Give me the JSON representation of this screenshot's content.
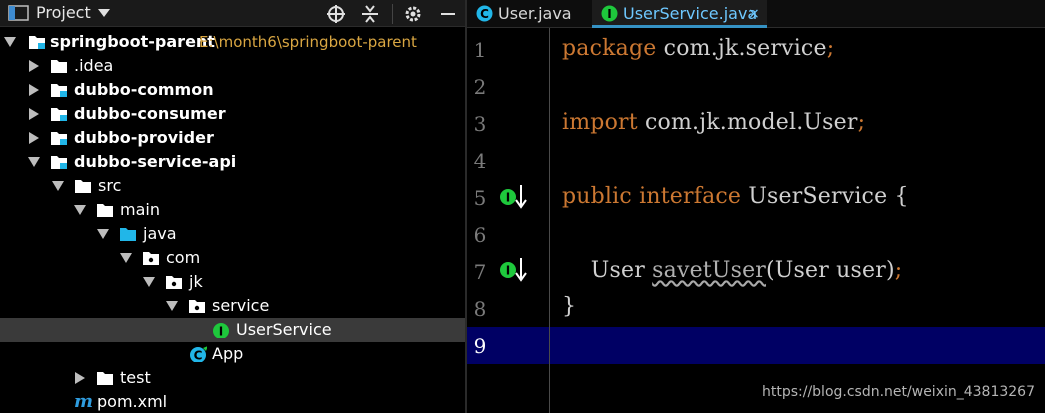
{
  "project_panel": {
    "title": "Project",
    "tree": [
      {
        "label": "springboot-parent",
        "path": "E:\\month6\\springboot-parent",
        "icon": "module-folder-icon",
        "expanded": true
      },
      {
        "label": ".idea",
        "icon": "folder-icon",
        "expanded": false
      },
      {
        "label": "dubbo-common",
        "icon": "module-folder-icon",
        "expanded": false
      },
      {
        "label": "dubbo-consumer",
        "icon": "module-folder-icon",
        "expanded": false
      },
      {
        "label": "dubbo-provider",
        "icon": "module-folder-icon",
        "expanded": false
      },
      {
        "label": "dubbo-service-api",
        "icon": "module-folder-icon",
        "expanded": true
      },
      {
        "label": "src",
        "icon": "folder-icon",
        "expanded": true
      },
      {
        "label": "main",
        "icon": "folder-icon",
        "expanded": true
      },
      {
        "label": "java",
        "icon": "source-folder-icon",
        "expanded": true
      },
      {
        "label": "com",
        "icon": "package-icon",
        "expanded": true
      },
      {
        "label": "jk",
        "icon": "package-icon",
        "expanded": true
      },
      {
        "label": "service",
        "icon": "package-icon",
        "expanded": true
      },
      {
        "label": "UserService",
        "icon": "interface-icon",
        "selected": true
      },
      {
        "label": "App",
        "icon": "class-icon"
      },
      {
        "label": "test",
        "icon": "folder-icon",
        "expanded": false
      },
      {
        "label": "pom.xml",
        "icon": "maven-icon"
      }
    ]
  },
  "editor": {
    "tabs": [
      {
        "label": "User.java",
        "icon": "class-icon",
        "active": false
      },
      {
        "label": "UserService.java",
        "icon": "interface-icon",
        "active": true,
        "close": "×"
      }
    ],
    "line_numbers": [
      "1",
      "2",
      "3",
      "4",
      "5",
      "6",
      "7",
      "8",
      "9"
    ],
    "lines": {
      "l1_kw": "package",
      "l1_rest": " com.jk.service",
      "l3_kw": "import",
      "l3_rest": " com.jk.model.User",
      "semi": ";",
      "l5_kw1": "public",
      "l5_kw2": "interface",
      "l5_rest": " UserService {",
      "l7_type": "    User ",
      "l7_method": "savetUser",
      "l7_params": "(User user)",
      "l8": "}"
    },
    "current_line": "9"
  },
  "watermark": "https://blog.csdn.net/weixin_43813267",
  "colors": {
    "keyword": "#cc7832",
    "interface_icon": "#1ec83c",
    "class_icon": "#21b6e8",
    "current_line_bg": "#000064",
    "path_text": "#d9a642"
  }
}
